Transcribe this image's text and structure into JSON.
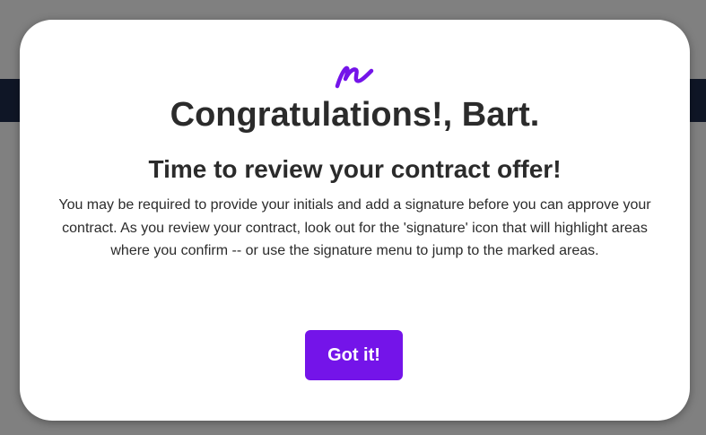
{
  "modal": {
    "logo_icon": "signature-scribble-icon",
    "title": "Congratulations!, Bart.",
    "subtitle": "Time to review your contract offer!",
    "body": "You may be required to provide your initials and add a signature before you can approve your contract. As you review your contract, look out for the 'signature' icon that will highlight areas where you confirm -- or use the signature menu to jump to the marked areas.",
    "confirm_label": "Got it!"
  },
  "colors": {
    "accent": "#7414e9",
    "overlay": "#808080",
    "navbar": "#0f1626",
    "text": "#2b2b2b"
  }
}
